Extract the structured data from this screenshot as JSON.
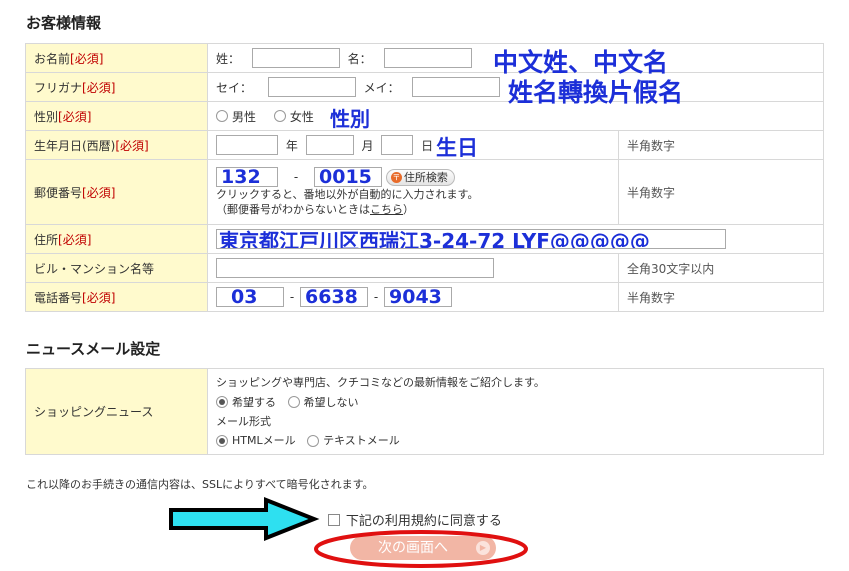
{
  "customer_section": {
    "title": "お客様情報"
  },
  "name_row": {
    "label": "お名前",
    "required": "[必須]",
    "sei_label": "姓：",
    "mei_label": "名：",
    "annotation": "中文姓、中文名"
  },
  "furigana_row": {
    "label": "フリガナ",
    "required": "[必須]",
    "sei_label": "セイ：",
    "mei_label": "メイ：",
    "annotation": "姓名轉換片假名"
  },
  "gender_row": {
    "label": "性別",
    "required": "[必須]",
    "male": "男性",
    "female": "女性",
    "annotation": "性別"
  },
  "birthday_row": {
    "label": "生年月日(西暦)",
    "required": "[必須]",
    "year_label": "年",
    "month_label": "月",
    "day_label": "日",
    "annotation": "生日",
    "note": "半角数字"
  },
  "postal_row": {
    "label": "郵便番号",
    "required": "[必須]",
    "part1": "132",
    "dash": "-",
    "part2": "0015",
    "search_button": "住所検索",
    "help1": "クリックすると、番地以外が自動的に入力されます。",
    "help2_pre": "（郵便番号がわからないときは",
    "help2_link": "こちら",
    "help2_post": "）",
    "note": "半角数字"
  },
  "address_row": {
    "label": "住所",
    "required": "[必須]",
    "value": "東京都江戸川区西瑞江3-24-72 LYF@@@@@"
  },
  "building_row": {
    "label": "ビル・マンション名等",
    "value": "",
    "note": "全角30文字以内"
  },
  "phone_row": {
    "label": "電話番号",
    "required": "[必須]",
    "part1": "03",
    "part2": "6638",
    "part3": "9043",
    "dash": "-",
    "note": "半角数字"
  },
  "news_section": {
    "title": "ニュースメール設定"
  },
  "news_row": {
    "label": "ショッピングニュース",
    "description": "ショッピングや専門店、クチコミなどの最新情報をご紹介します。",
    "want": "希望する",
    "not_want": "希望しない",
    "format_label": "メール形式",
    "html": "HTMLメール",
    "text": "テキストメール"
  },
  "ssl_notice": "これ以降のお手続きの通信内容は、SSLによりすべて暗号化されます。",
  "agree_label": "下記の利用規約に同意する",
  "next_button": "次の画面へ",
  "colors": {
    "label_bg": "#fffacd",
    "required": "#c00000",
    "annotation": "#1c2fd8",
    "arrow_fill": "#2ee0f0",
    "highlight_ring": "#e01010",
    "next_button": "#f2b6a5"
  }
}
